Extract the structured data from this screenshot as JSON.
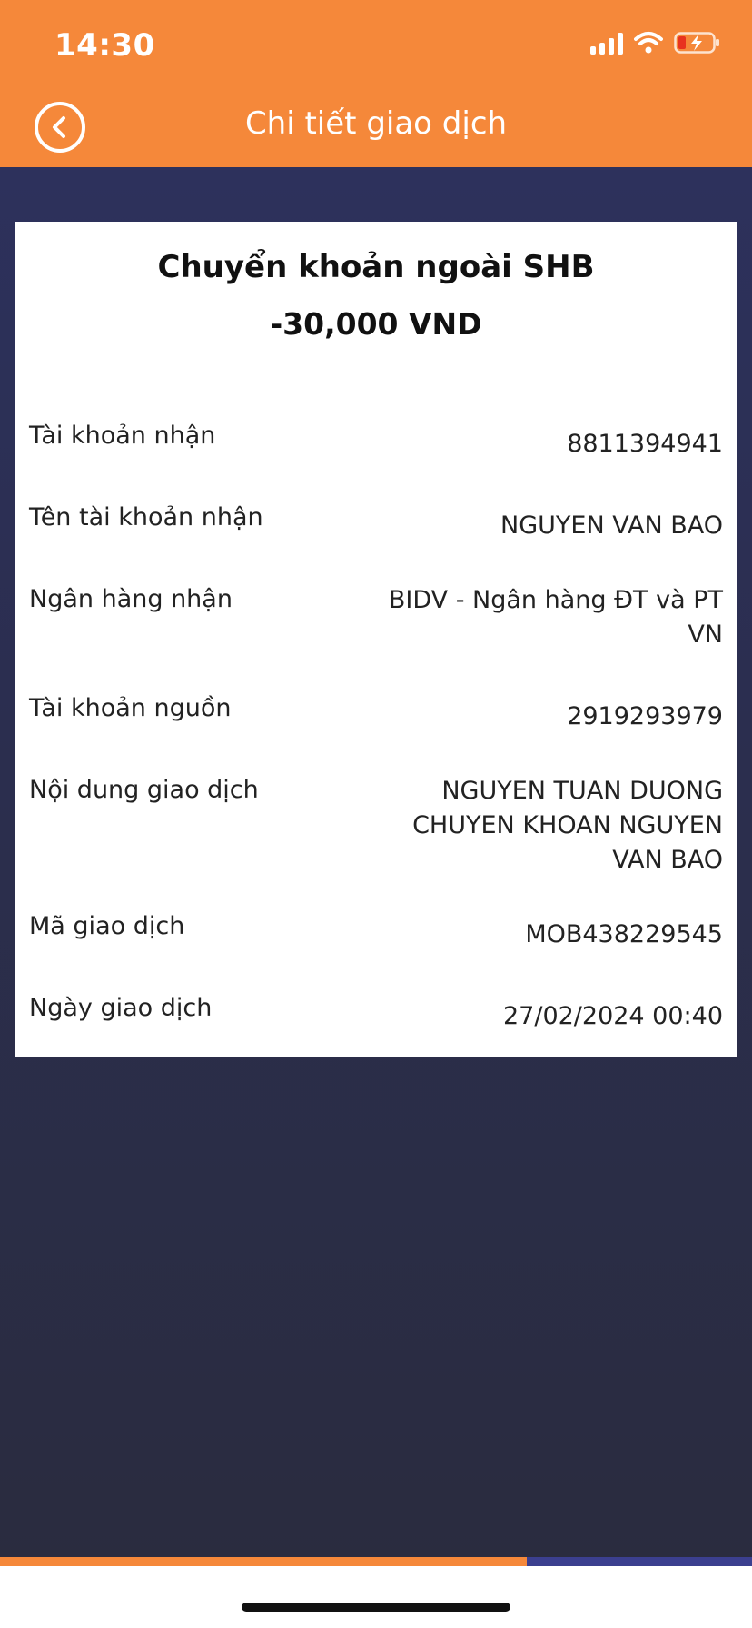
{
  "status_bar": {
    "time": "14:30",
    "icons": [
      "cellular-signal-icon",
      "wifi-icon",
      "battery-low-charging-icon"
    ]
  },
  "nav": {
    "title": "Chi tiết giao dịch",
    "back_icon": "chevron-left-circle-icon"
  },
  "transaction": {
    "title": "Chuyển khoản ngoài SHB",
    "amount": "-30,000 VND",
    "rows": [
      {
        "label": "Tài khoản nhận",
        "value": "8811394941"
      },
      {
        "label": "Tên tài khoản nhận",
        "value": "NGUYEN VAN BAO"
      },
      {
        "label": "Ngân hàng nhận",
        "value": "BIDV - Ngân hàng ĐT và PT VN"
      },
      {
        "label": "Tài khoản nguồn",
        "value": "2919293979"
      },
      {
        "label": "Nội dung giao dịch",
        "value": "NGUYEN TUAN DUONG CHUYEN KHOAN NGUYEN VAN BAO"
      },
      {
        "label": "Mã giao dịch",
        "value": "MOB438229545"
      },
      {
        "label": "Ngày giao dịch",
        "value": "27/02/2024 00:40"
      }
    ]
  },
  "colors": {
    "header": "#f5883a",
    "background": "#2b2d42",
    "card": "#ffffff",
    "progress_accent": "#3b3f8f"
  }
}
